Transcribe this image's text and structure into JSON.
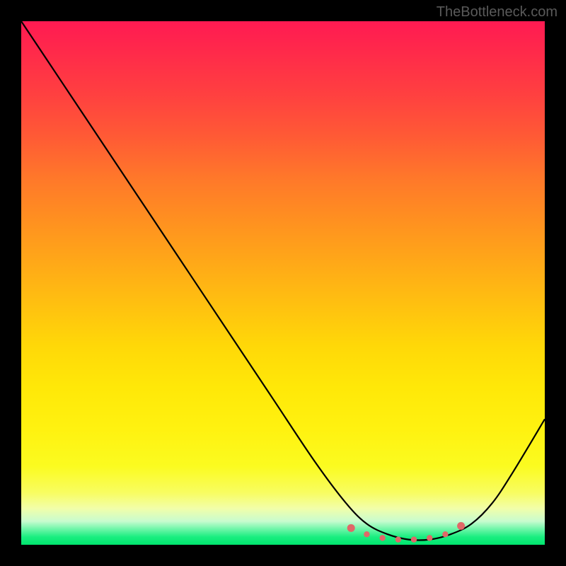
{
  "watermark": "TheBottleneck.com",
  "chart_data": {
    "type": "line",
    "title": "",
    "xlabel": "",
    "ylabel": "",
    "xlim": [
      0,
      100
    ],
    "ylim": [
      0,
      100
    ],
    "series": [
      {
        "name": "bottleneck-curve",
        "x": [
          0,
          8,
          16,
          24,
          32,
          40,
          48,
          56,
          62,
          66,
          70,
          74,
          78,
          82,
          86,
          90,
          94,
          100
        ],
        "y": [
          100,
          88,
          76,
          64,
          52,
          40,
          28,
          16,
          8,
          4,
          2,
          1,
          1,
          2,
          4,
          8,
          14,
          24
        ]
      }
    ],
    "markers": {
      "name": "highlight-dots",
      "x": [
        63,
        66,
        69,
        72,
        75,
        78,
        81,
        84
      ],
      "y": [
        3.2,
        2.0,
        1.3,
        1.0,
        1.0,
        1.3,
        2.0,
        3.6
      ],
      "color": "#e06868"
    },
    "gradient_stops": [
      {
        "pos": 0.0,
        "color": "#ff1a52"
      },
      {
        "pos": 0.5,
        "color": "#ffc010"
      },
      {
        "pos": 0.9,
        "color": "#f8fd60"
      },
      {
        "pos": 1.0,
        "color": "#00e56e"
      }
    ]
  }
}
